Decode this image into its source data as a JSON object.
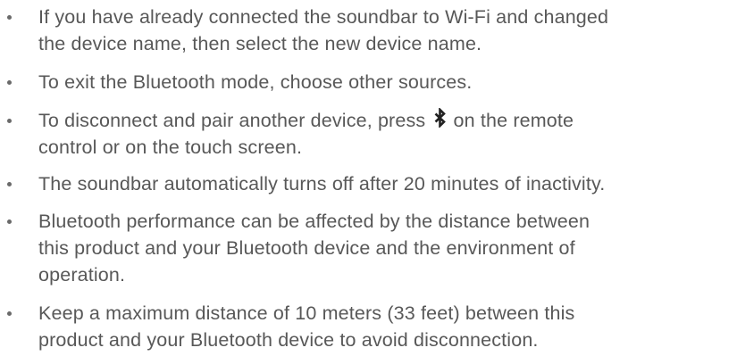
{
  "notes": [
    {
      "lines": [
        "If you have already connected the soundbar to Wi-Fi and changed",
        "the device name, then select the new device name."
      ]
    },
    {
      "lines": [
        "To exit the Bluetooth mode, choose other sources."
      ]
    },
    {
      "line1_before_icon": "To disconnect and pair another device, press",
      "icon": "bluetooth-icon",
      "line1_after_icon": "on the remote",
      "line2": "control or on the touch screen."
    },
    {
      "lines": [
        "The soundbar automatically turns off after 20 minutes of inactivity."
      ]
    },
    {
      "lines": [
        "Bluetooth performance can be affected by the distance between",
        "this product and your Bluetooth device and the environment of",
        "operation."
      ]
    },
    {
      "lines": [
        "Keep a maximum distance of 10 meters (33 feet) between this",
        "product and your Bluetooth device to avoid disconnection."
      ]
    }
  ],
  "colors": {
    "text": "#585858",
    "bullet": "#6a6a6a",
    "background": "#ffffff"
  }
}
